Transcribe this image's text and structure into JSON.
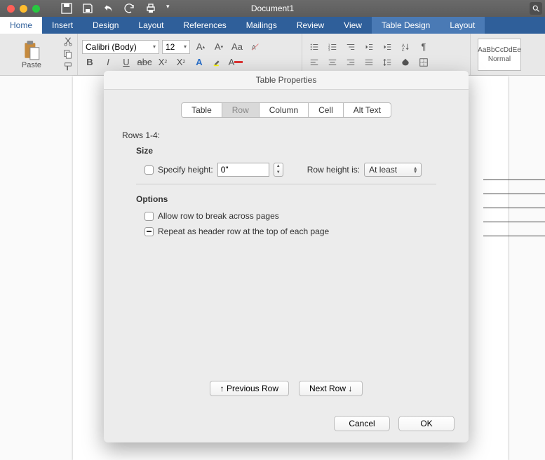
{
  "titlebar": {
    "document_title": "Document1"
  },
  "ribbon_tabs": {
    "home": "Home",
    "insert": "Insert",
    "design": "Design",
    "layout": "Layout",
    "references": "References",
    "mailings": "Mailings",
    "review": "Review",
    "view": "View",
    "table_design": "Table Design",
    "table_layout": "Layout"
  },
  "ribbon": {
    "paste_label": "Paste",
    "font_name": "Calibri (Body)",
    "font_size": "12",
    "style_preview": "AaBbCcDdEe",
    "style_name": "Normal"
  },
  "dialog": {
    "title": "Table Properties",
    "tabs": {
      "table": "Table",
      "row": "Row",
      "column": "Column",
      "cell": "Cell",
      "alt_text": "Alt Text"
    },
    "rows_label": "Rows 1-4:",
    "size_label": "Size",
    "specify_height_label": "Specify height:",
    "height_value": "0\"",
    "row_height_is_label": "Row height is:",
    "row_height_mode": "At least",
    "options_label": "Options",
    "allow_break_label": "Allow row to break across pages",
    "repeat_header_label": "Repeat as header row at the top of each page",
    "prev_row": "↑  Previous Row",
    "next_row": "Next Row  ↓",
    "cancel": "Cancel",
    "ok": "OK"
  }
}
